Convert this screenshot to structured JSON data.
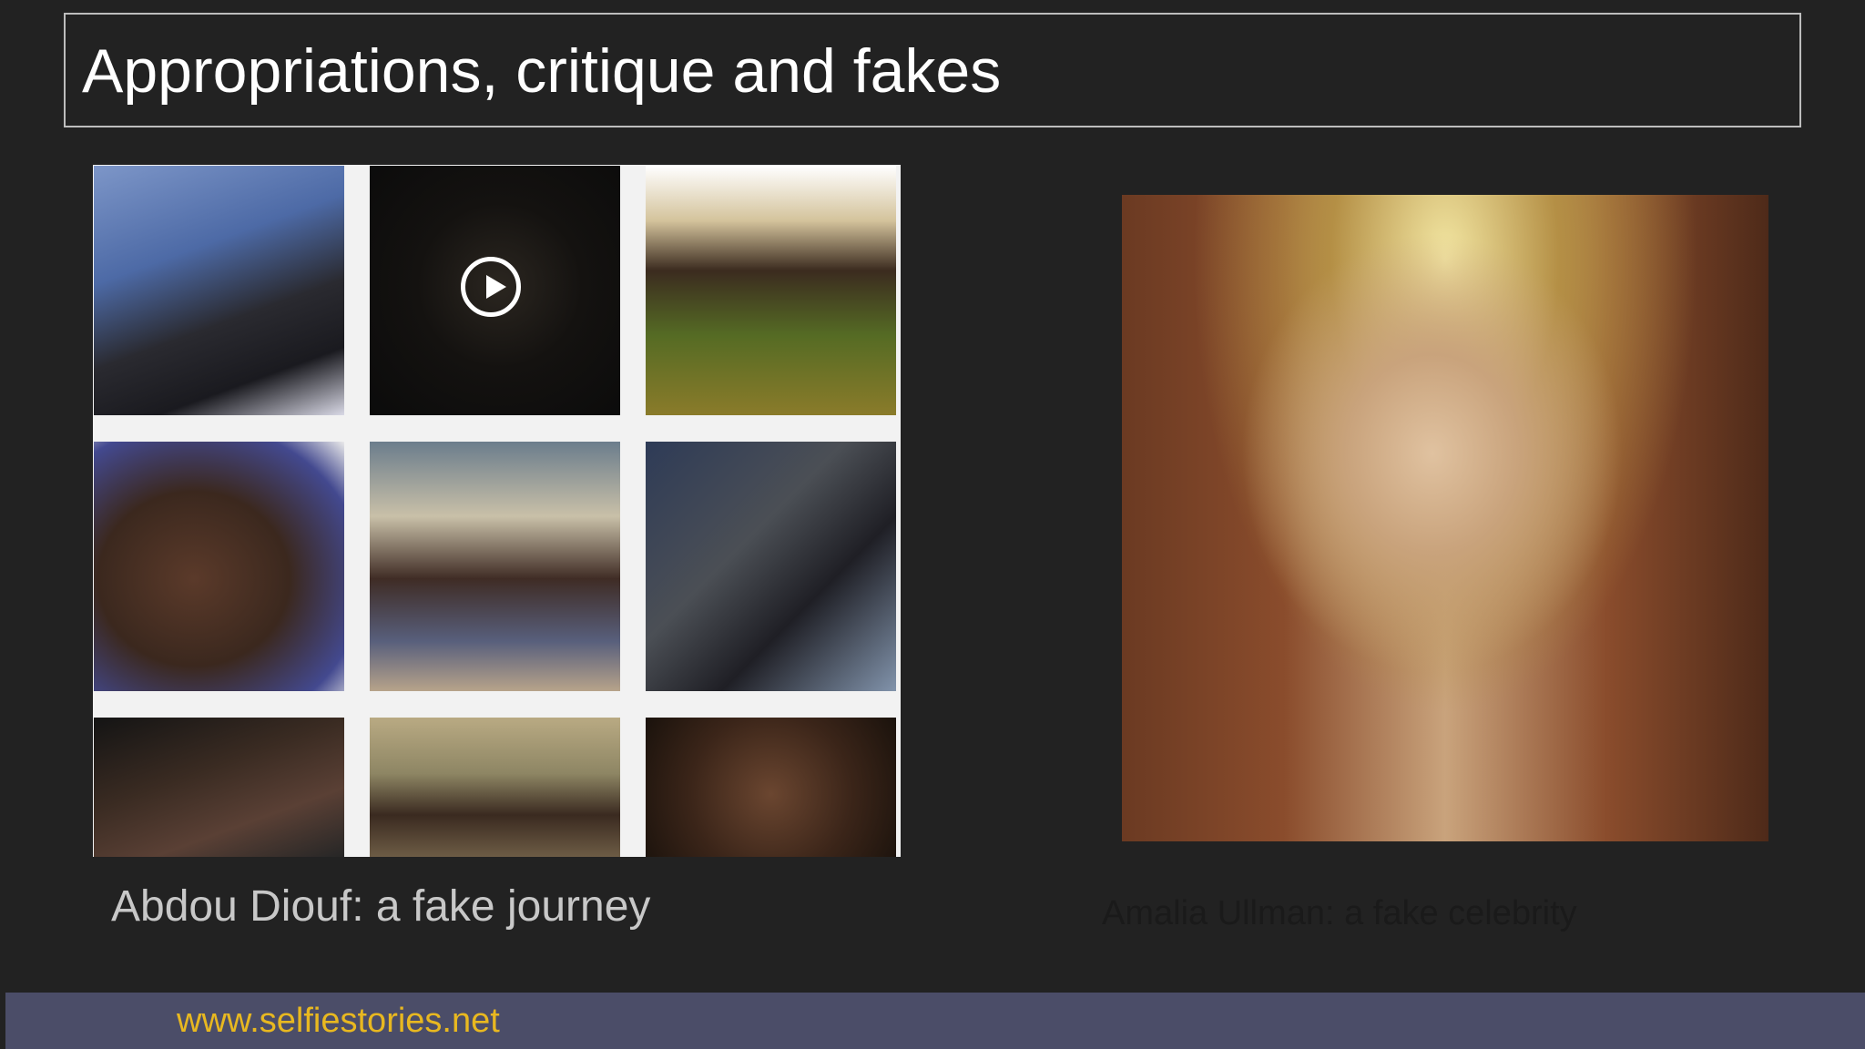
{
  "slide": {
    "title": "Appropriations, critique and fakes",
    "left_caption": "Abdou Diouf: a fake journey",
    "right_caption": "Amalia Ullman: a fake celebrity",
    "footer_link": "www.selfiestories.net"
  },
  "colors": {
    "background": "#222222",
    "title_text": "#ffffff",
    "footer_bar": "#4b4d68",
    "footer_link": "#e8b820",
    "left_caption": "#c8c8c8",
    "right_caption": "#1a1a1a"
  },
  "icons": {
    "video_tile": "play-icon"
  }
}
